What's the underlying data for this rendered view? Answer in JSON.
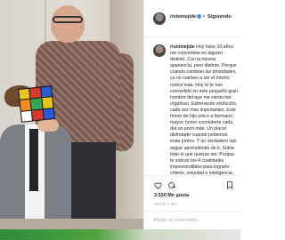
{
  "header": {
    "username": "ristomejide",
    "separator": "•",
    "follow_status": "Siguiendo"
  },
  "post": {
    "username": "ristomejide",
    "caption": "Hoy hace 10 años me convertiste en alguien distinto. Con la misma apariencia, pero distinto. Porque cuando cambian las prioridades, ya no vuelves a ser el mismo nunca más. Hoy tú te has convertido en este pequeño gran hombre del que me siento tan orgulloso. Estrenando evolución, cada vez más importantes. Este honor de hijo único a hermano mayor, honor concederte cada día un poco más. Un placer disfrutarte cuando podemos estar juntos. Y un verdadero lujo seguir aprendiendo de ti. Sobre todo lo que quieras ser. Porque te sobran las 4 cualidades imprescindibles para lograrlo: criterio, voluntad e inteligencia.",
    "likes": "3.530 Me gusta",
    "time_ago": "HACE 1 DÍA",
    "comment_placeholder": "Añade un comentario..."
  },
  "photo": {
    "cube_colors": [
      "#e8c51d",
      "#d33a2c",
      "#2a5bd7",
      "#f28c1c",
      "#2fa84f",
      "#e8c51d",
      "#ffffff",
      "#d33a2c",
      "#2a5bd7"
    ]
  },
  "colors": {
    "verified": "#3897f0",
    "text": "#262626",
    "muted": "#999999"
  }
}
